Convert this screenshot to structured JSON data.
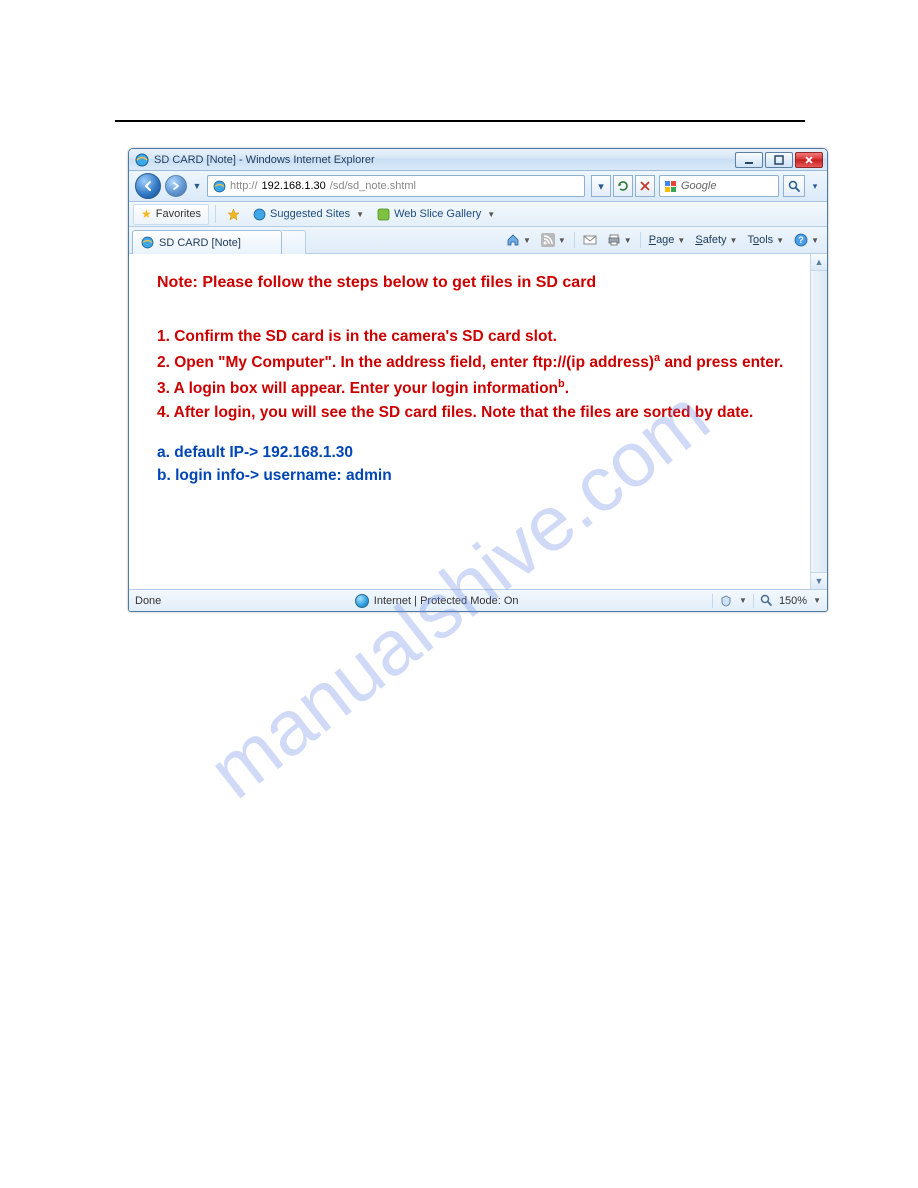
{
  "watermark": "manualshive.com",
  "window": {
    "title": "SD CARD [Note] - Windows Internet Explorer",
    "controls": {
      "min_icon": "minimize-icon",
      "max_icon": "maximize-icon",
      "close_icon": "close-icon"
    }
  },
  "address": {
    "url_prefix": "http://",
    "url_host": "192.168.1.30",
    "url_path": "/sd/sd_note.shtml",
    "refresh_icon": "refresh-icon",
    "stop_icon": "stop-icon",
    "search_placeholder": "Google",
    "search_engine_icon": "google-icon",
    "search_go_icon": "search-icon"
  },
  "favbar": {
    "favorites_label": "Favorites",
    "suggested_label": "Suggested Sites",
    "webslice_label": "Web Slice Gallery"
  },
  "tab": {
    "label": "SD CARD [Note]",
    "icon": "ie-page-icon"
  },
  "cmdbar": {
    "home_icon": "home-icon",
    "feeds_icon": "rss-icon",
    "mail_icon": "read-mail-icon",
    "print_icon": "print-icon",
    "page_label": "Page",
    "safety_label": "Safety",
    "tools_label": "Tools",
    "help_icon": "help-icon"
  },
  "content": {
    "heading": "Note: Please follow the steps below to get files in SD card",
    "step1": "1. Confirm the SD card is in the camera's SD card slot.",
    "step2_a": "2. Open \"My Computer\". In the address field, enter ftp://(ip address)",
    "step2_sup": "a",
    "step2_b": "and press enter.",
    "step3_a": "3. A login box will appear. Enter your login information",
    "step3_sup": "b",
    "step3_b": ".",
    "step4": "4. After login, you will see the SD card files. Note that the files are sorted by date.",
    "note_a": "a. default IP-> 192.168.1.30",
    "note_b": "b. login info-> username: admin"
  },
  "statusbar": {
    "left": "Done",
    "center": "Internet | Protected Mode: On",
    "zoom": "150%"
  }
}
